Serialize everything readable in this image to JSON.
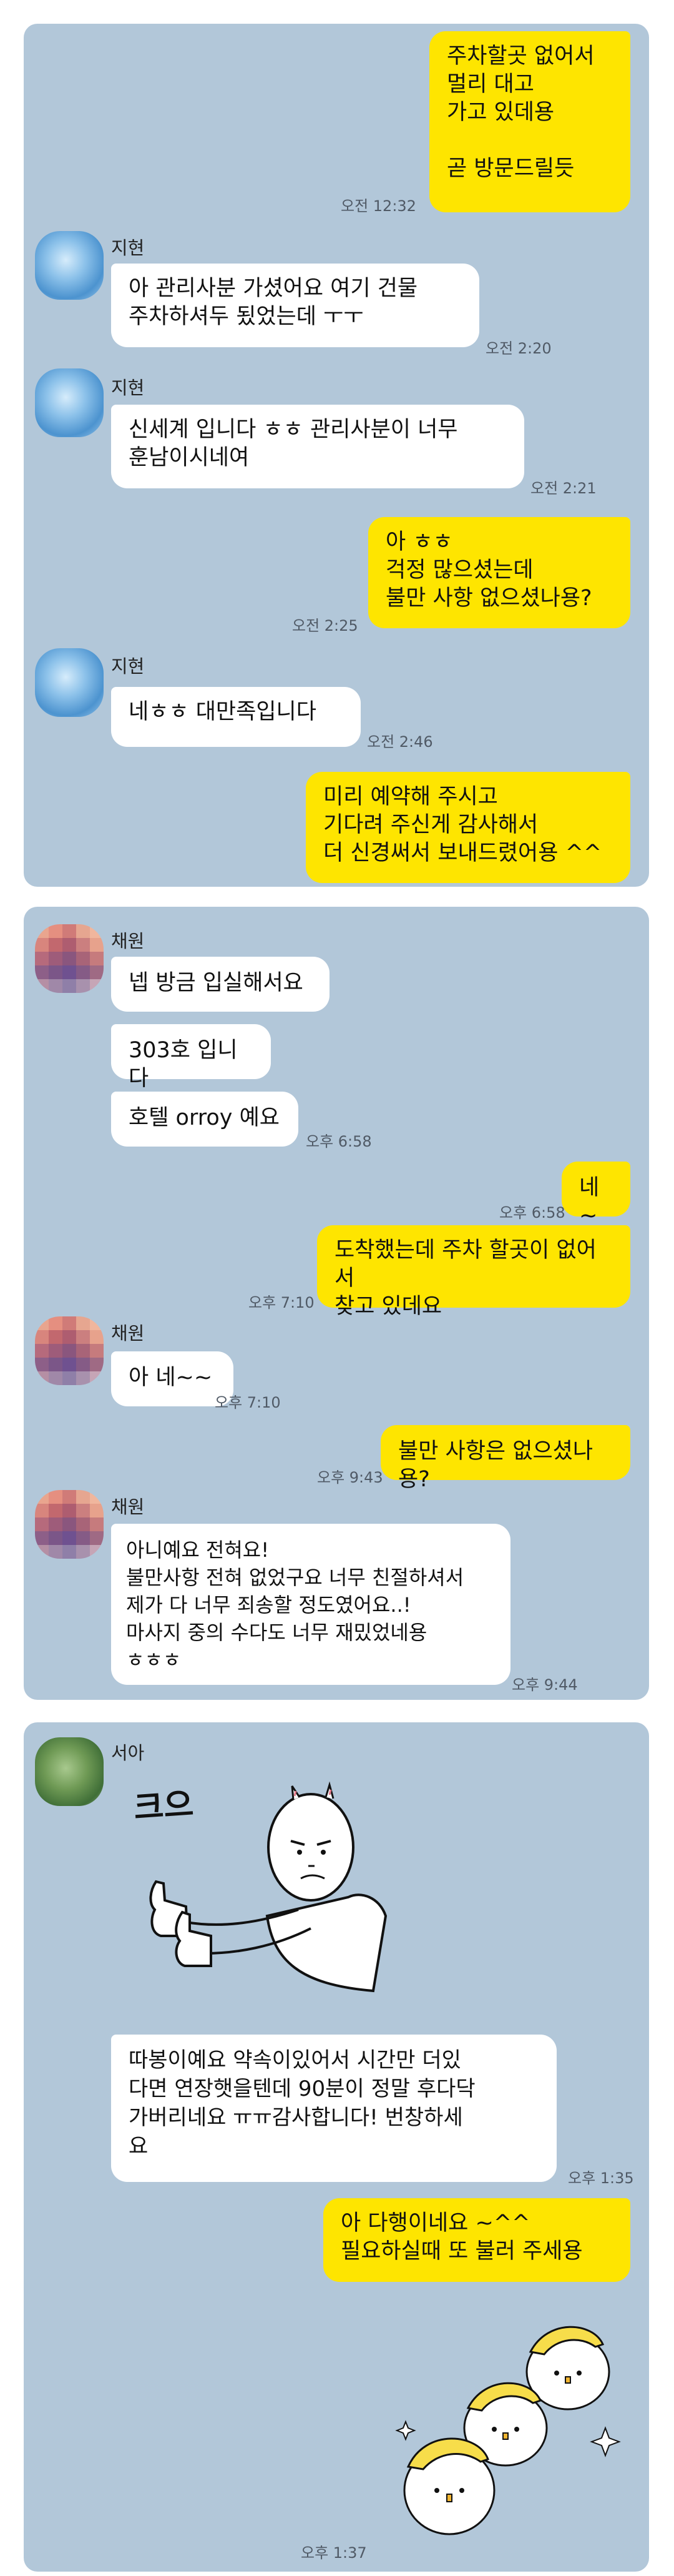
{
  "chat1": {
    "messages": [
      {
        "sender": "me",
        "text": "주차할곳 없어서\n멀리 대고\n가고 있데용\n\n곧 방문드릴듯",
        "time": "오전 12:32"
      },
      {
        "sender": "지현",
        "text": "아 관리사분 가셨어요 여기 건물\n주차하셔두 됬었는데 ㅜㅜ",
        "time": "오전 2:20"
      },
      {
        "sender": "지현",
        "text": "신세계 입니다 ㅎㅎ 관리사분이 너무\n훈남이시네여",
        "time": "오전 2:21"
      },
      {
        "sender": "me",
        "text": "아 ㅎㅎ\n걱정 많으셨는데\n불만 사항 없으셨나용?",
        "time": "오전 2:25"
      },
      {
        "sender": "지현",
        "text": "네ㅎㅎ 대만족입니다",
        "time": "오전 2:46"
      },
      {
        "sender": "me",
        "text": "미리 예약해 주시고\n기다려 주신게 감사해서\n더 신경써서 보내드렸어용 ^^",
        "time": ""
      }
    ]
  },
  "chat2": {
    "messages": [
      {
        "sender": "채원",
        "text": "넵 방금 입실해서요",
        "time": ""
      },
      {
        "sender": "채원",
        "text": "303호 입니다",
        "time": ""
      },
      {
        "sender": "채원",
        "text": "호텔 orroy 예요",
        "time": "오후 6:58"
      },
      {
        "sender": "me",
        "text": "네 ~",
        "time": "오후 6:58"
      },
      {
        "sender": "me",
        "text": "도착했는데  주차 할곳이 없어서\n찾고 있데요",
        "time": "오후 7:10"
      },
      {
        "sender": "채원",
        "text": "아 네~~",
        "time": "오후 7:10"
      },
      {
        "sender": "me",
        "text": "불만 사항은 없으셨나용?",
        "time": "오후 9:43"
      },
      {
        "sender": "채원",
        "text": "아니예요 전혀요!\n불만사항 전혀 없었구요 너무 친절하셔서\n제가 다 너무 죄송할 정도였어요..!\n마사지 중의 수다도 너무 재밌었네용\nㅎㅎㅎ",
        "time": "오후 9:44"
      }
    ]
  },
  "chat3": {
    "messages": [
      {
        "sender": "서아",
        "sticker_text": "크으",
        "text": "따봉이예요 약속이있어서 시간만 더있\n다면 연장햇을텐데 90분이 정말 후다닥\n가버리네요 ㅠㅠ감사합니다! 번창하세\n요",
        "time": "오후 1:35"
      },
      {
        "sender": "me",
        "text": "아 다행이네요 ~^^\n필요하실때 또 불러 주세용",
        "time": "오후 1:37"
      }
    ]
  },
  "colors": {
    "chat_bg": "#b2c7d9",
    "my_bubble": "#fee500",
    "their_bubble": "#ffffff"
  }
}
